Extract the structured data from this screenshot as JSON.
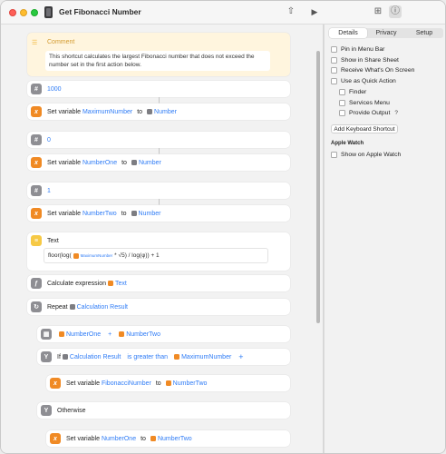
{
  "window": {
    "title": "Get Fibonacci Number"
  },
  "toolbar": {
    "share_icon": "share-icon",
    "run_icon": "play-icon",
    "library_icon": "library-icon",
    "info_icon": "info-icon"
  },
  "actions": {
    "comment": {
      "title": "Comment",
      "text": "This shortcut calculates the largest Fibonacci number that does not exceed the number set in the first action below."
    },
    "number1": {
      "value": "1000"
    },
    "setvar1": {
      "label": "Set variable",
      "var": "MaximumNumber",
      "to": "to",
      "source": "Number"
    },
    "number2": {
      "value": "0"
    },
    "setvar2": {
      "label": "Set variable",
      "var": "NumberOne",
      "to": "to",
      "source": "Number"
    },
    "number3": {
      "value": "1"
    },
    "setvar3": {
      "label": "Set variable",
      "var": "NumberTwo",
      "to": "to",
      "source": "Number"
    },
    "text": {
      "title": "Text",
      "formula_prefix": "floor(log(",
      "formula_token": "MaximumNumber",
      "formula_suffix": " * √5) / log(φ)) + 1"
    },
    "calc": {
      "label": "Calculate expression",
      "source": "Text"
    },
    "repeat": {
      "label": "Repeat",
      "source": "Calculation Result"
    },
    "math": {
      "left": "NumberOne",
      "op": "+",
      "right": "NumberTwo"
    },
    "if": {
      "label": "If",
      "source": "Calculation Result",
      "condition": "is greater than",
      "compare": "MaximumNumber",
      "add": "+"
    },
    "setvar4": {
      "label": "Set variable",
      "var": "FibonacciNumber",
      "to": "to",
      "source": "NumberTwo"
    },
    "otherwise": {
      "label": "Otherwise"
    },
    "setvar5": {
      "label": "Set variable",
      "var": "NumberOne",
      "to": "to",
      "source": "NumberTwo"
    }
  },
  "inspector": {
    "tabs": [
      "Details",
      "Privacy",
      "Setup"
    ],
    "active_tab": "Details",
    "options": {
      "pin_menu_bar": "Pin in Menu Bar",
      "share_sheet": "Show in Share Sheet",
      "receive_screen": "Receive What's On Screen",
      "quick_action": "Use as Quick Action",
      "finder": "Finder",
      "services_menu": "Services Menu",
      "provide_output": "Provide Output",
      "provide_output_help": "?"
    },
    "add_shortcut_button": "Add Keyboard Shortcut",
    "apple_watch": {
      "title": "Apple Watch",
      "show_on_watch": "Show on Apple Watch"
    }
  },
  "colors": {
    "accent_blue": "#2f7cf6",
    "variable_orange": "#f08a24",
    "comment_bg": "#fff5de"
  }
}
